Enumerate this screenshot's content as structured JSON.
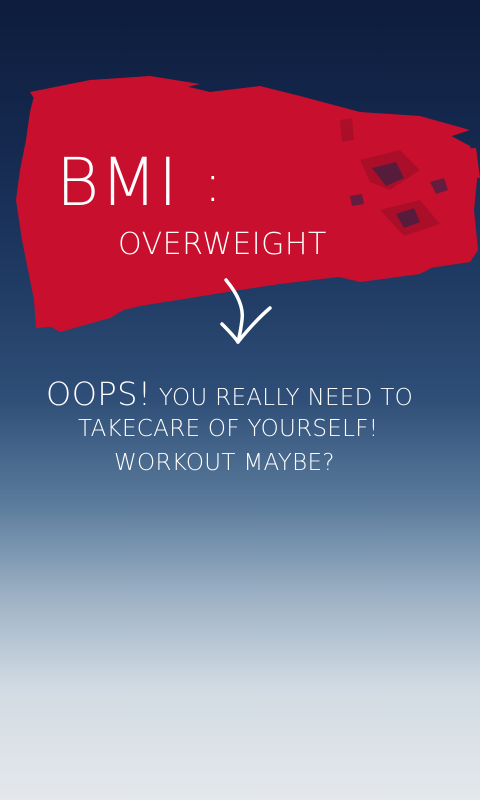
{
  "result": {
    "label": "BMI",
    "colon": ":",
    "category": "OVERWEIGHT"
  },
  "message": {
    "exclaim": "OOPS!",
    "line1_rest": " YOU REALLY NEED TO",
    "line2": "TAKECARE OF YOURSELF!",
    "line3": "WORKOUT MAYBE?"
  },
  "colors": {
    "paint_stroke": "#c8102e",
    "text": "#ffffff",
    "background_top": "#0d1c3c",
    "background_bottom": "#e4e8ec"
  },
  "icons": {
    "paint": "red-paint-stroke",
    "arrow": "hand-drawn-down-arrow-icon"
  }
}
